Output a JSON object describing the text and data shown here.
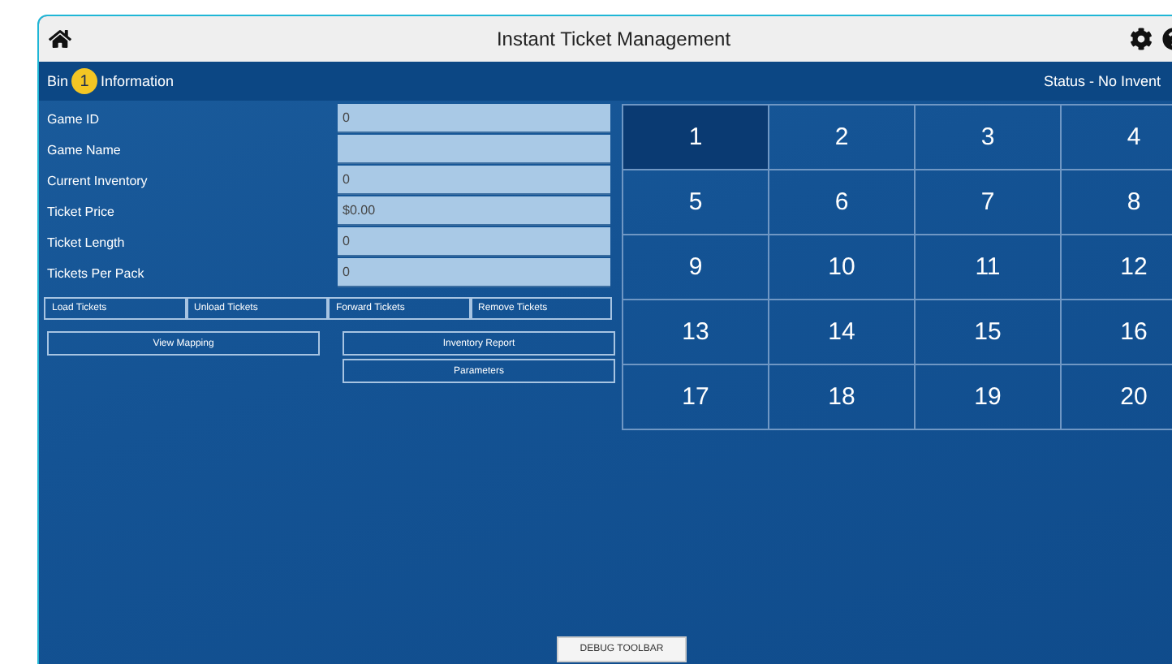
{
  "window": {
    "title": "Instant Ticket Management"
  },
  "header": {
    "bin_prefix": "Bin",
    "bin_number": "1",
    "bin_suffix": "Information",
    "status": "Status - No Invent"
  },
  "fields": [
    {
      "label": "Game ID",
      "value": "0"
    },
    {
      "label": "Game Name"
    },
    {
      "label": "Current Inventory",
      "value": "0"
    },
    {
      "label": "Ticket Price",
      "value": "$0.00"
    },
    {
      "label": "Ticket Length",
      "value": "0"
    },
    {
      "label": "Tickets Per Pack",
      "value": "0"
    }
  ],
  "ticket_buttons": [
    "Load Tickets",
    "Unload Tickets",
    "Forward Tickets",
    "Remove Tickets"
  ],
  "left_buttons": [
    "View Mapping"
  ],
  "right_buttons": [
    "Inventory Report",
    "Parameters"
  ],
  "bins": [
    {
      "label": "1",
      "selected": true
    },
    {
      "label": "2",
      "selected": false
    },
    {
      "label": "3",
      "selected": false
    },
    {
      "label": "4",
      "selected": false
    },
    {
      "label": "5",
      "selected": false
    },
    {
      "label": "6",
      "selected": false
    },
    {
      "label": "7",
      "selected": false
    },
    {
      "label": "8",
      "selected": false
    },
    {
      "label": "9",
      "selected": false
    },
    {
      "label": "10",
      "selected": false
    },
    {
      "label": "11",
      "selected": false
    },
    {
      "label": "12",
      "selected": false
    },
    {
      "label": "13",
      "selected": false
    },
    {
      "label": "14",
      "selected": false
    },
    {
      "label": "15",
      "selected": false
    },
    {
      "label": "16",
      "selected": false
    },
    {
      "label": "17",
      "selected": false
    },
    {
      "label": "18",
      "selected": false
    },
    {
      "label": "19",
      "selected": false
    },
    {
      "label": "20",
      "selected": false
    }
  ],
  "debug_button": "DEBUG TOOLBAR"
}
